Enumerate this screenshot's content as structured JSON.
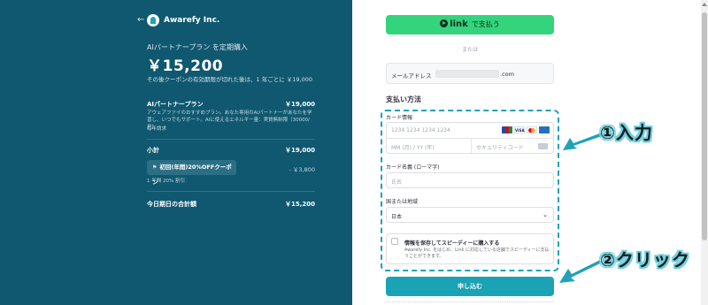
{
  "summary": {
    "back_arrow": "←",
    "company": "Awarefy Inc.",
    "plan_line": "AIパートナープラン を定期購入",
    "price": "￥15,200",
    "price_note": "その後クーポンの有効期限が切れた後は、1 年ごとに ￥19,000",
    "item": {
      "name": "AIパートナープラン",
      "price": "￥19,000",
      "description": "アウェアファイのおすすめプラン。あなた専用のAIパートナーがあなたを学習し、いつでもサポート。AIに使えるエネルギー量：実質無制限（30000/月）",
      "period": "毎年請求"
    },
    "subtotal_label": "小計",
    "subtotal_value": "￥19,000",
    "coupon": {
      "icon": "tag-icon",
      "name": "初回(年間)20%OFFクーポン",
      "discount": "- ￥3,800",
      "sub": "1 年間 20% 割引"
    },
    "total_label": "今日期日の合計額",
    "total_value": "￥15,200"
  },
  "payment": {
    "link_word": "link",
    "link_pay": "で支払う",
    "or": "または",
    "email_label": "メールアドレス",
    "email_domain": ".com",
    "method_title": "支払い方法",
    "card_label": "カード情報",
    "card_number_placeholder": "1234 1234 1234 1234",
    "card_brands": [
      "JCB",
      "VISA",
      "MC",
      "AMEX"
    ],
    "expiry_placeholder": "MM (月) / YY (年)",
    "cvc_placeholder": "セキュリティコード",
    "name_label": "カード名義 (ローマ字)",
    "name_placeholder": "氏名",
    "country_label": "国または地域",
    "country_value": "日本",
    "save_title": "情報を保存してスピーディーに購入する",
    "save_desc": "Awarefy Inc. をはじめ、Link に対応している店舗でスピーディーに支払うことができます。",
    "submit": "申し込む"
  },
  "annotations": {
    "step1": "①入力",
    "step2": "②クリック",
    "color": "#1fa2ba"
  },
  "colors": {
    "left_bg": "#0f5870",
    "link_green": "#33d47c",
    "submit": "#1aa3b5"
  }
}
